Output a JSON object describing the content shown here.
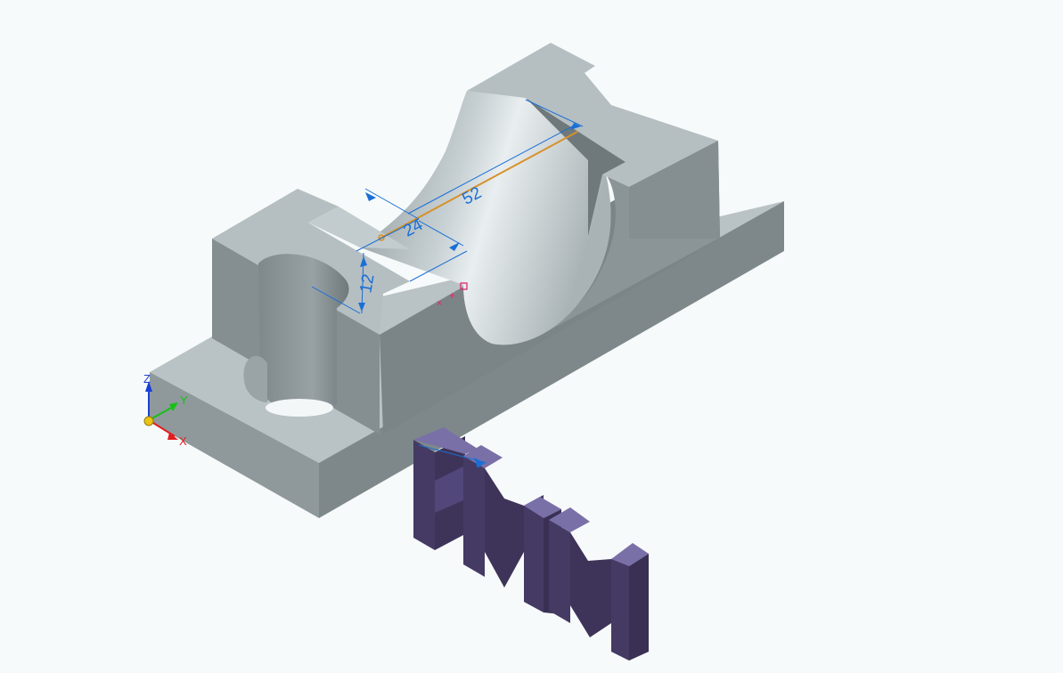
{
  "viewport": {
    "background": "#f7fafa"
  },
  "dimensions": {
    "d1": "52",
    "d2": "24",
    "d3": "12"
  },
  "triad": {
    "x_label": "X",
    "y_label": "Y",
    "z_label": "Z",
    "x_color": "#e21d1d",
    "y_color": "#16c016",
    "z_color": "#1a3fd6"
  },
  "colors": {
    "part_top": "#b9c3c6",
    "part_side_dark": "#7b8588",
    "part_side_mid": "#8e989b",
    "bore": "#c9d3d6",
    "text_solid_front": "#453a63",
    "text_solid_top": "#7a70a8",
    "dimension": "#1a6fd6",
    "sketch_line": "#d8912a",
    "relation_marker": "#e02a6b"
  }
}
